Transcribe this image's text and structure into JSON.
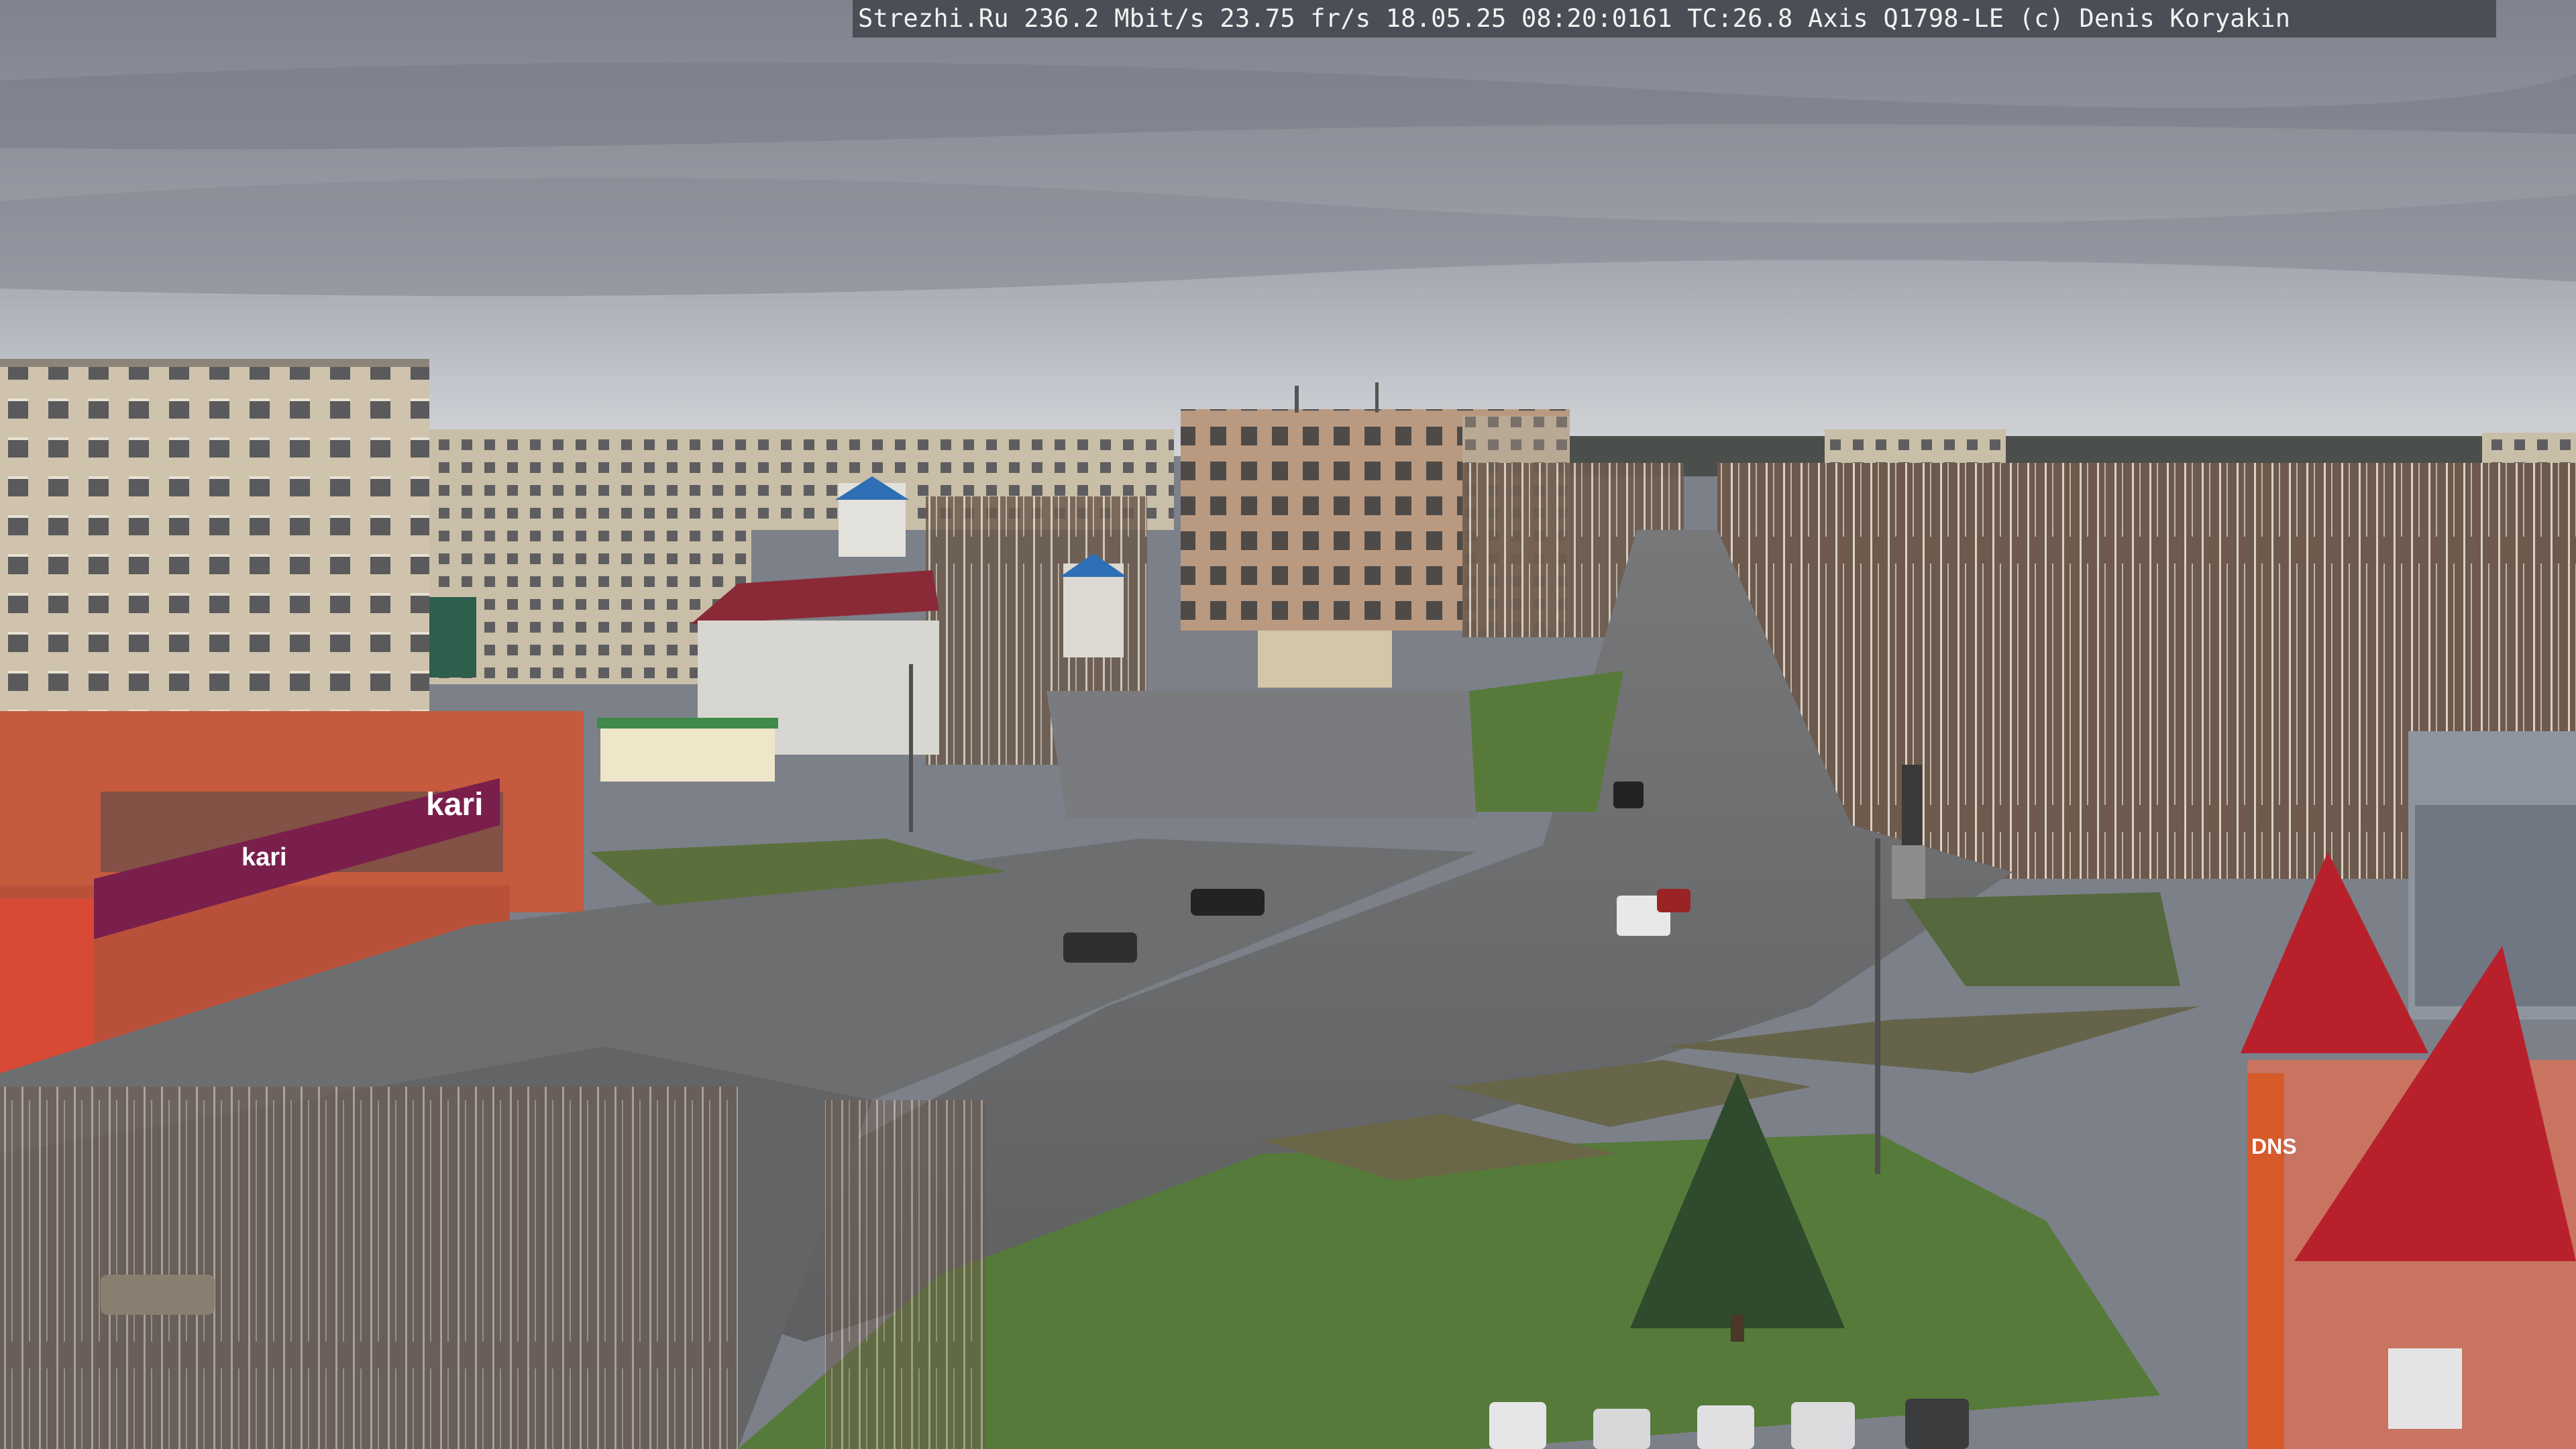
{
  "overlay": {
    "caption": "Strezhi.Ru 236.2 Mbit/s 23.75 fr/s 18.05.25 08:20:0161 TC:26.8  Axis Q1798-LE  (c) Denis Koryakin"
  },
  "signs": {
    "kari_large": "kari",
    "kari_small": "kari",
    "dns": "DNS"
  },
  "colors": {
    "sky": "#8a8e98",
    "sky_light": "#c3c6cc",
    "asphalt": "#6b6c6e",
    "grass": "#5c7a3e",
    "store_facade": "#c8543a",
    "kari_sign": "#7a1f4c",
    "red_roof": "#b8202c"
  }
}
